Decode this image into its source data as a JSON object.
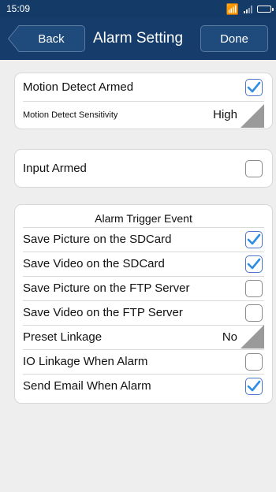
{
  "status": {
    "time": "15:09"
  },
  "nav": {
    "back_label": "Back",
    "title": "Alarm Setting",
    "done_label": "Done"
  },
  "motion_group": {
    "rows": [
      {
        "label": "Motion Detect Armed",
        "checked": true
      },
      {
        "label": "Motion Detect Sensitivity",
        "value": "High"
      }
    ]
  },
  "input_group": {
    "rows": [
      {
        "label": "Input Armed",
        "checked": false
      }
    ]
  },
  "trigger_group": {
    "heading": "Alarm Trigger Event",
    "rows": [
      {
        "label": "Save Picture on the SDCard",
        "checked": true
      },
      {
        "label": "Save Video on the SDCard",
        "checked": true
      },
      {
        "label": "Save Picture on the FTP Server",
        "checked": false
      },
      {
        "label": "Save Video on the FTP Server",
        "checked": false
      },
      {
        "label": "Preset Linkage",
        "value": "No"
      },
      {
        "label": "IO Linkage When Alarm",
        "checked": false
      },
      {
        "label": "Send Email When Alarm",
        "checked": true
      }
    ]
  },
  "colors": {
    "nav_bar": "#153c6a",
    "check_accent": "#2f8de4"
  },
  "icons": {
    "check": "check-icon",
    "wifi": "wifi-icon",
    "signal": "signal-icon",
    "battery": "battery-icon"
  }
}
